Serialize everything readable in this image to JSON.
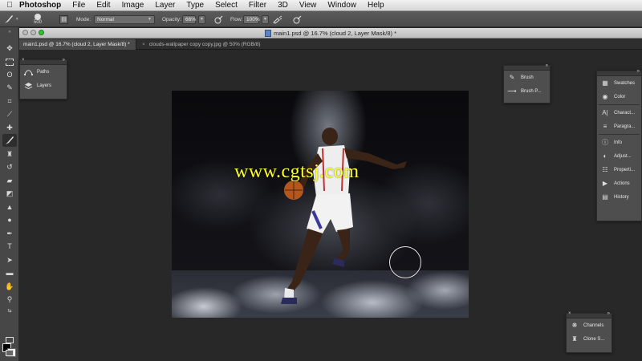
{
  "menubar": {
    "app_name": "Photoshop",
    "items": [
      "File",
      "Edit",
      "Image",
      "Layer",
      "Type",
      "Select",
      "Filter",
      "3D",
      "View",
      "Window",
      "Help"
    ]
  },
  "options": {
    "brush_size": "500",
    "mode_label": "Mode:",
    "mode_value": "Normal",
    "opacity_label": "Opacity:",
    "opacity_value": "66%",
    "flow_label": "Flow:",
    "flow_value": "100%"
  },
  "document": {
    "title": "main1.psd @ 16.7% (cloud 2, Layer Mask/8) *",
    "tabs": [
      {
        "label": "main1.psd @ 16.7% (cloud 2, Layer Mask/8) *",
        "active": true
      },
      {
        "label": "clouds-wallpaper copy copy.jpg @ 50% (RGB/8)",
        "active": false
      }
    ]
  },
  "panels": {
    "left_group": [
      {
        "label": "Paths",
        "icon": "paths-icon"
      },
      {
        "label": "Layers",
        "icon": "layers-icon"
      }
    ],
    "brush_group": [
      {
        "label": "Brush",
        "icon": "brush-icon"
      },
      {
        "label": "Brush P...",
        "icon": "brush-presets-icon"
      }
    ],
    "right_dock": [
      {
        "label": "Swatches",
        "icon": "swatches-icon"
      },
      {
        "label": "Color",
        "icon": "color-icon"
      },
      {
        "label": "Charact...",
        "icon": "character-icon"
      },
      {
        "label": "Paragra...",
        "icon": "paragraph-icon"
      },
      {
        "label": "Info",
        "icon": "info-icon"
      },
      {
        "label": "Adjust...",
        "icon": "adjustments-icon"
      },
      {
        "label": "Properti...",
        "icon": "properties-icon"
      },
      {
        "label": "Actions",
        "icon": "actions-icon"
      },
      {
        "label": "History",
        "icon": "history-icon"
      }
    ],
    "bottom_group": [
      {
        "label": "Channels",
        "icon": "channels-icon"
      },
      {
        "label": "Clone S...",
        "icon": "clone-source-icon"
      }
    ]
  },
  "canvas": {
    "watermark": "www.cgtsj.com",
    "watermark_color": "#ffff2a"
  },
  "colors": {
    "foreground": "#000000",
    "background": "#ffffff"
  }
}
